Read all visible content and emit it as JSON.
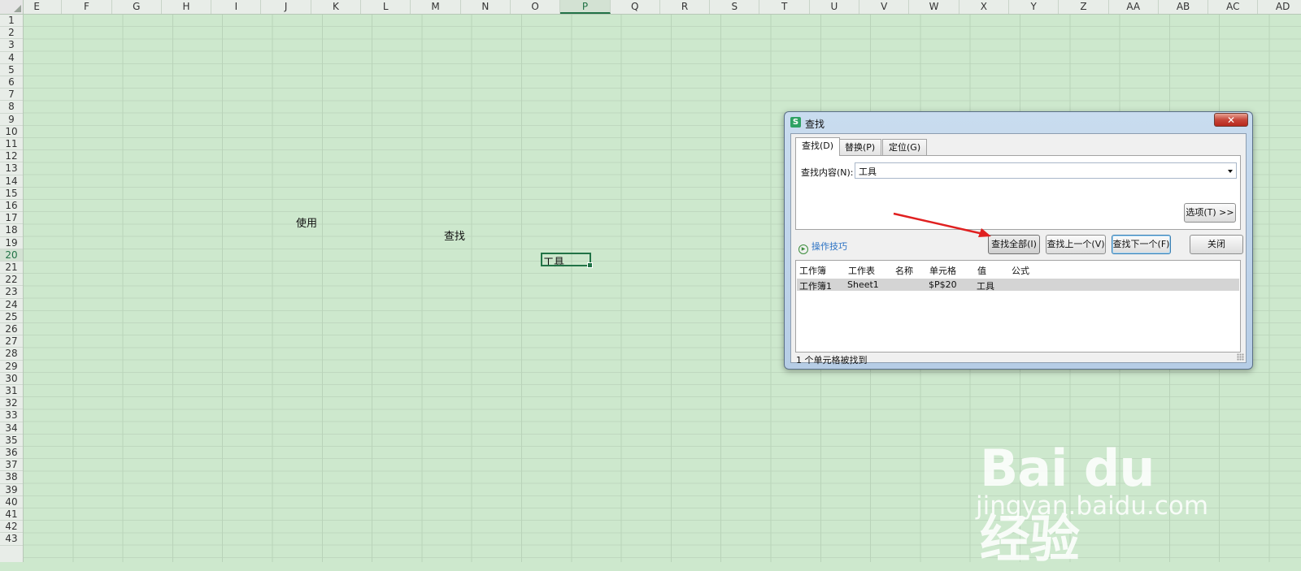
{
  "sheet": {
    "columns": [
      "E",
      "F",
      "G",
      "H",
      "I",
      "J",
      "K",
      "L",
      "M",
      "N",
      "O",
      "P",
      "Q",
      "R",
      "S",
      "T",
      "U",
      "V",
      "W",
      "X",
      "Y",
      "Z",
      "AA",
      "AB",
      "AC",
      "AD"
    ],
    "selected_column": "P",
    "rows": [
      "1",
      "2",
      "3",
      "4",
      "5",
      "6",
      "7",
      "8",
      "9",
      "10",
      "11",
      "12",
      "13",
      "14",
      "15",
      "16",
      "17",
      "18",
      "19",
      "20",
      "21",
      "22",
      "23",
      "24",
      "25",
      "26",
      "27",
      "28",
      "29",
      "30",
      "31",
      "32",
      "33",
      "34",
      "35",
      "36",
      "37",
      "38",
      "39",
      "40",
      "41",
      "42",
      "43"
    ],
    "selected_row": "20",
    "cells": {
      "K17": "使用",
      "N18": "查找",
      "P20": "工具"
    }
  },
  "dialog": {
    "title": "查找",
    "app_icon_letter": "S",
    "close_glyph": "✕",
    "tabs": [
      "查找(D)",
      "替换(P)",
      "定位(G)"
    ],
    "active_tab": 0,
    "find_label": "查找内容(N):",
    "find_value": "工具",
    "options_button": "选项(T) >>",
    "tips_link": "操作技巧",
    "buttons": {
      "find_all": "查找全部(I)",
      "find_prev": "查找上一个(V)",
      "find_next": "查找下一个(F)",
      "close": "关闭"
    },
    "results": {
      "headers": [
        "工作簿",
        "工作表",
        "名称",
        "单元格",
        "值",
        "公式"
      ],
      "rows": [
        [
          "工作簿1",
          "Sheet1",
          "",
          "$P$20",
          "工具",
          ""
        ]
      ]
    },
    "status": "1 个单元格被找到"
  },
  "watermark": {
    "brand": "Bai du 经验",
    "url": "jingyan.baidu.com"
  },
  "colors": {
    "sheet_bg": "#cde8cd",
    "accent_green": "#217346",
    "arrow_red": "#e02020",
    "link_blue": "#2b72c4"
  }
}
